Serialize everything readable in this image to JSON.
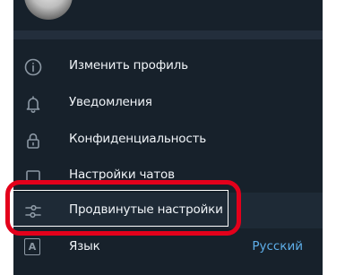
{
  "menu": {
    "items": [
      {
        "id": "edit-profile",
        "label": "Изменить профиль",
        "icon": "info-icon"
      },
      {
        "id": "notifications",
        "label": "Уведомления",
        "icon": "bell-icon"
      },
      {
        "id": "privacy",
        "label": "Конфиденциальность",
        "icon": "lock-icon"
      },
      {
        "id": "chat-settings",
        "label": "Настройки чатов",
        "icon": "chat-icon"
      },
      {
        "id": "advanced",
        "label": "Продвинутые настройки",
        "icon": "sliders-icon"
      },
      {
        "id": "language",
        "label": "Язык",
        "icon": "language-icon",
        "value": "Русский",
        "icon_letter": "A"
      }
    ]
  },
  "colors": {
    "panel_bg": "#17212b",
    "text": "#f0f4f8",
    "icon": "#8c98a4",
    "accent": "#5eaee9",
    "annotation": "#e3001b"
  }
}
